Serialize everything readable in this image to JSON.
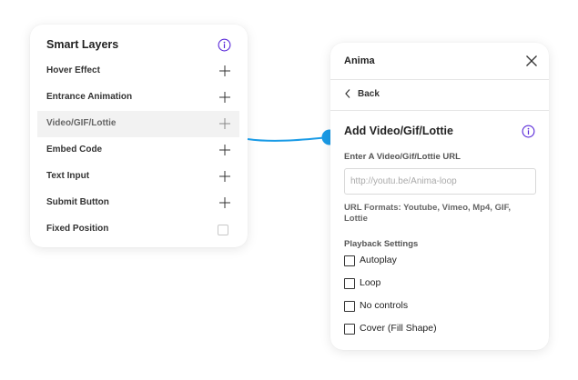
{
  "smart_layers": {
    "title": "Smart Layers",
    "items": [
      {
        "label": "Hover Effect",
        "control": "plus"
      },
      {
        "label": "Entrance Animation",
        "control": "plus"
      },
      {
        "label": "Video/GIF/Lottie",
        "control": "plus",
        "highlighted": true
      },
      {
        "label": "Embed Code",
        "control": "plus"
      },
      {
        "label": "Text Input",
        "control": "plus"
      },
      {
        "label": "Submit Button",
        "control": "plus"
      },
      {
        "label": "Fixed Position",
        "control": "checkbox"
      }
    ]
  },
  "anima_panel": {
    "title": "Anima",
    "back_label": "Back",
    "section_title": "Add Video/Gif/Lottie",
    "url_label": "Enter A Video/Gif/Lottie URL",
    "url_placeholder": "http://youtu.be/Anima-loop",
    "url_value": "",
    "formats_text": "URL Formats: Youtube, Vimeo, Mp4, GIF, Lottie",
    "playback_title": "Playback Settings",
    "options": [
      {
        "label": "Autoplay",
        "checked": false
      },
      {
        "label": "Loop",
        "checked": false
      },
      {
        "label": "No controls",
        "checked": false
      },
      {
        "label": "Cover (Fill Shape)",
        "checked": false
      }
    ]
  },
  "colors": {
    "accent_purple": "#5b2bd9",
    "connector_blue": "#1a9be6",
    "highlight_row": "#f2f2f2"
  },
  "icons": [
    "info-icon",
    "plus-icon",
    "close-icon",
    "chevron-left-icon",
    "checkbox-icon"
  ]
}
